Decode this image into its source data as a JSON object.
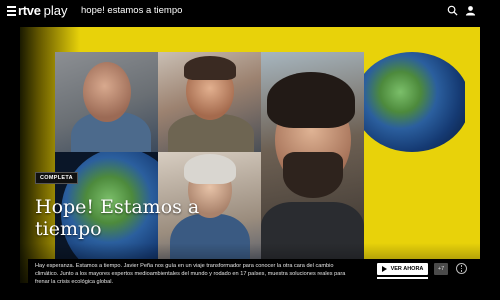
{
  "header": {
    "logo_brand": "rtve",
    "logo_product": "play",
    "title": "hope! estamos a tiempo",
    "icons": [
      "menu-icon",
      "search-icon",
      "user-icon"
    ]
  },
  "hero": {
    "badge": "COMPLETA",
    "title": "Hope! Estamos a tiempo",
    "description": "Hay esperanza. Estamos a tiempo. Javier Peña nos guía en un viaje transformador para conocer la otra cara del cambio climático. Junto a los mayores expertos medioambientales del mundo y rodado en 17 países, muestra soluciones reales para frenar la crisis ecológica global.",
    "watch_label": "VER AHORA",
    "age_rating": "+7",
    "accent_color": "#e8d20a"
  }
}
